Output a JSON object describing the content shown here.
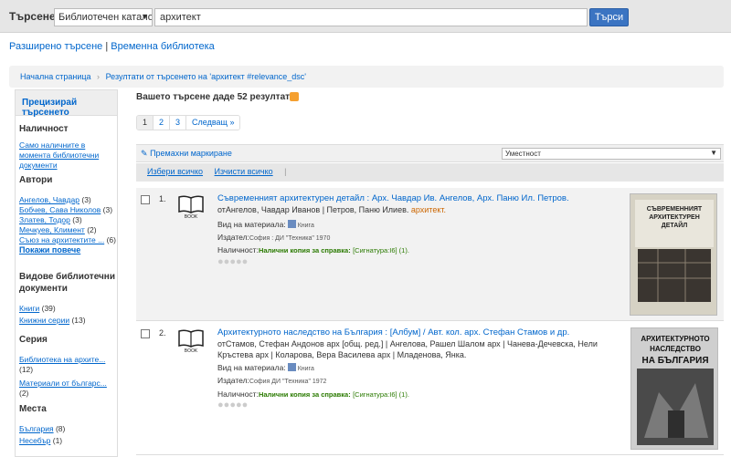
{
  "search": {
    "label": "Търсене",
    "scope": "Библиотечен каталог",
    "query": "архитект",
    "button": "Търси"
  },
  "links": {
    "advanced": "Разширено търсене",
    "sep": "|",
    "cart": "Временна библиотека"
  },
  "breadcrumb": [
    "Начална страница",
    "Резултати от търсенето на 'архитект #relevance_dsc'"
  ],
  "sidebar": {
    "header": "Прецизирай търсенето",
    "availability": {
      "title": "Наличност",
      "item": "Само наличните в момента библиотечни документи"
    },
    "authors": {
      "title": "Автори",
      "items": [
        {
          "name": "Ангелов, Чавдар",
          "count": "(3)"
        },
        {
          "name": "Бобчев, Сава Николов",
          "count": "(3)"
        },
        {
          "name": "Златев, Тодор",
          "count": "(3)"
        },
        {
          "name": "Мечкуев, Климент",
          "count": "(2)"
        },
        {
          "name": "Съюз на архитектите ...",
          "count": "(6)"
        }
      ],
      "more": "Покажи повече"
    },
    "types": {
      "title": "Видове библиотечни документи",
      "items": [
        {
          "name": "Книги",
          "count": "(39)"
        },
        {
          "name": "Книжни серии",
          "count": "(13)"
        }
      ]
    },
    "series": {
      "title": "Серия",
      "items": [
        {
          "name": "Библиотека на архите...",
          "count": "(12)"
        },
        {
          "name": "Материали от българс...",
          "count": "(2)"
        }
      ]
    },
    "places": {
      "title": "Места",
      "items": [
        {
          "name": "България",
          "count": "(8)"
        },
        {
          "name": "Несебър",
          "count": "(1)"
        }
      ]
    }
  },
  "results": {
    "count_text": "Вашето търсене даде 52 резултата.",
    "pages": [
      "1",
      "2",
      "3",
      "Следващ »"
    ],
    "unmark": "Премахни маркиране",
    "sort": "Уместност",
    "select_all": "Избери всичко",
    "clear_all": "Изчисти всичко",
    "pipe": "|",
    "records": [
      {
        "num": "1.",
        "title": "Съвременният архитектурен детайл : Арх. Чавдар Ив. Ангелов, Арх. Паню Ил. Петров.",
        "authors": "отАнгелов, Чавдар Иванов | Петров, Паню Илиев.",
        "highlight": "архитект.",
        "type_label": "Вид на материала:",
        "type_value": "Книга",
        "pub_label": "Издател:",
        "pub_value": "София : ДИ \"Техника\" 1970",
        "avail_label": "Наличност:",
        "avail_value": "Налични копия за справка:",
        "call": "[Сигнатура:I6] (1).",
        "cover_lines": [
          "СЪВРЕМЕННИЯТ",
          "АРХИТЕКТУРЕН",
          "ДЕТАЙЛ"
        ]
      },
      {
        "num": "2.",
        "title": "Архитектурното наследство на България : [Албум] / Авт. кол. арх. Стефан Стамов и др.",
        "authors": "отСтамов, Стефан Андонов арх [общ. ред.] | Ангелова, Рашел Шалом арх | Чанева-Дечевска, Нели Кръстева арх | Коларова, Вера Василева арх | Младенова, Янка.",
        "highlight": "",
        "type_label": "Вид на материала:",
        "type_value": "Книга",
        "pub_label": "Издател:",
        "pub_value": "София ДИ \"Техника\" 1972",
        "avail_label": "Наличност:",
        "avail_value": "Налични копия за справка:",
        "call": "[Сигнатура:I6] (1).",
        "cover_lines": [
          "АРХИТЕКТУРНОТО",
          "НАСЛЕДСТВО",
          "НА БЪЛГАРИЯ"
        ]
      }
    ]
  },
  "colors": {
    "accent": "#0066cc",
    "button": "#3b74c2",
    "available": "#2a7a00",
    "highlight": "#cc6600"
  },
  "icons": [
    "book-icon",
    "rss-icon",
    "material-type-icon",
    "star-icon",
    "checkbox-icon"
  ]
}
